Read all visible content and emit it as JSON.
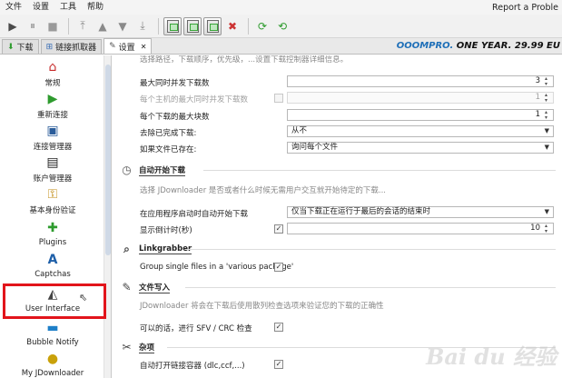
{
  "menu": {
    "items": [
      "文件",
      "设置",
      "工具",
      "帮助"
    ],
    "report": "Report a Proble"
  },
  "tabs": [
    {
      "label": "下载",
      "icon": "download-arrow-icon"
    },
    {
      "label": "链接抓取器",
      "icon": "linkgrabber-icon"
    },
    {
      "label": "设置",
      "icon": "wrench-icon"
    }
  ],
  "banner": {
    "brand": "OOOMPRO.",
    "promo": " ONE YEAR. 29.99 EU"
  },
  "sidebar": {
    "items": [
      {
        "label": "常规",
        "icon": "house-icon"
      },
      {
        "label": "重新连接",
        "icon": "reconnect-icon"
      },
      {
        "label": "连接管理器",
        "icon": "network-icon"
      },
      {
        "label": "账户管理器",
        "icon": "account-icon"
      },
      {
        "label": "基本身份验证",
        "icon": "key-users-icon"
      },
      {
        "label": "Plugins",
        "icon": "puzzle-icon"
      },
      {
        "label": "Captchas",
        "icon": "captcha-icon"
      },
      {
        "label": "User Interface",
        "icon": "user-interface-icon"
      },
      {
        "label": "Bubble Notify",
        "icon": "bubble-icon"
      },
      {
        "label": "My JDownloader",
        "icon": "jd-icon"
      }
    ]
  },
  "main": {
    "top_desc": "选择路径，下载顺序，优先级，...设置下载控制器详细信息。",
    "rows": {
      "max_sim": {
        "label": "最大同时并发下载数",
        "value": "3"
      },
      "max_per_host": {
        "label": "每个主机的最大同时并发下载数",
        "value": "1"
      },
      "max_chunks": {
        "label": "每个下载的最大块数",
        "value": "1"
      },
      "remove_done": {
        "label": "去除已完成下载:",
        "value": "从不"
      },
      "if_exists": {
        "label": "如果文件已存在:",
        "value": "询问每个文件"
      }
    },
    "autostart": {
      "title": "自动开始下载",
      "desc": "选择 JDownloader 是否或者什么时候无需用户交互就开始待定的下载...",
      "start_label": "在应用程序启动时自动开始下载",
      "start_value": "仅当下载正在运行于最后的会话的结束时",
      "countdown_label": "显示倒计时(秒)",
      "countdown_value": "10"
    },
    "linkgrabber": {
      "title": "Linkgrabber",
      "group_label": "Group single files in a 'various package'"
    },
    "filewrite": {
      "title": "文件写入",
      "desc": "JDownloader 将会在下载后使用散列检查选项来验证您的下载的正确性",
      "sfv_label": "可以的话，进行 SFV / CRC 检查"
    },
    "misc": {
      "title": "杂项",
      "autoopen_label": "自动打开链接容器 (dlc,ccf,...)"
    },
    "watermark": "Bai du 经验"
  }
}
